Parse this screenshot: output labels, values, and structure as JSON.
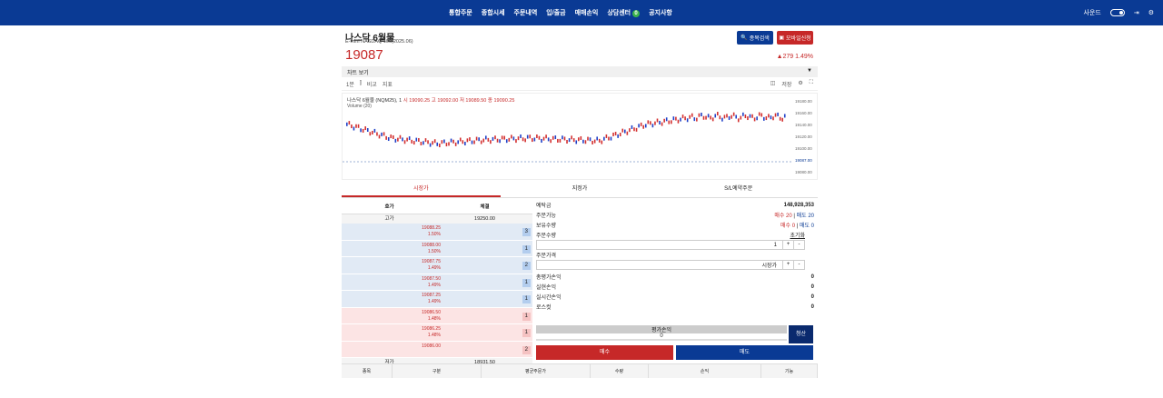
{
  "nav": [
    "통합주문",
    "종합시세",
    "주문내역",
    "입/출금",
    "매매손익",
    "상담센터",
    "공지사항"
  ],
  "nav_badge": "0",
  "top_right": {
    "sound_label": "사운드"
  },
  "product": {
    "name": "나스닥 6월물",
    "sub": "E-mini NASDAQ 100(2025.06)",
    "price": "19087",
    "change": "▲279",
    "change_pct": "1.49%"
  },
  "buttons": {
    "search": "종목검색",
    "order": "모바일신청"
  },
  "chart_title": "차트 보기",
  "chart_tools": {
    "interval": "1분",
    "compare": "비교",
    "indicator": "지표",
    "save": "저장"
  },
  "chart_legend": {
    "symbol": "나스닥 6월물 (NQM25), 1",
    "open": "시 19090.25",
    "high": "고 19092.00",
    "low": "저 19089.50",
    "close": "종 19090.25",
    "volume": "Volume (20)"
  },
  "chart_data": {
    "type": "line",
    "y_ticks": [
      "19180.00",
      "19160.00",
      "19140.00",
      "19120.00",
      "19100.00",
      "19087.00",
      "19080.00"
    ],
    "last_price": 19087
  },
  "tabs": [
    "시장가",
    "지정가",
    "S/L예약주문"
  ],
  "orderbook": {
    "headers": [
      "호가",
      "체결"
    ],
    "high_label": "고가",
    "high": "19250.00",
    "low_label": "저가",
    "low": "18931.50",
    "rows": [
      {
        "price": "19088.25",
        "pct": "1.50%",
        "qty": "3",
        "side": "sell"
      },
      {
        "price": "19088.00",
        "pct": "1.50%",
        "qty": "1",
        "side": "sell"
      },
      {
        "price": "19087.75",
        "pct": "1.49%",
        "qty": "2",
        "side": "sell"
      },
      {
        "price": "19087.50",
        "pct": "1.49%",
        "qty": "1",
        "side": "sell"
      },
      {
        "price": "19087.25",
        "pct": "1.49%",
        "qty": "1",
        "side": "sell"
      },
      {
        "price": "19086.50",
        "pct": "1.48%",
        "qty": "1",
        "side": "buy"
      },
      {
        "price": "19086.25",
        "pct": "1.48%",
        "qty": "1",
        "side": "buy"
      },
      {
        "price": "19086.00",
        "pct": "",
        "qty": "2",
        "side": "buy"
      }
    ]
  },
  "form": {
    "deposit_label": "예탁금",
    "deposit": "148,928,353",
    "orderable_label": "주문가능",
    "buy_avail": "매수 20",
    "sell_avail": "매도 20",
    "holding_label": "보유수량",
    "buy_hold": "매수 0",
    "sell_hold": "매도 0",
    "qty_label": "주문수량",
    "reset": "초기화",
    "qty": "1",
    "price_label": "주문가격",
    "price_type": "시장가",
    "eval_label": "총평가손익",
    "eval": "0",
    "realized_label": "실현손익",
    "realized": "0",
    "realtime_label": "실시간손익",
    "realtime": "0",
    "loss_label": "로스컷",
    "losscut": "0"
  },
  "pnl": {
    "label": "평가손익",
    "value": "0",
    "settle": "청산"
  },
  "actions": {
    "buy": "매수",
    "sell": "매도"
  },
  "bottom_headers": [
    "종목",
    "구분",
    "평균주문가",
    "수량",
    "손익",
    "기능"
  ]
}
